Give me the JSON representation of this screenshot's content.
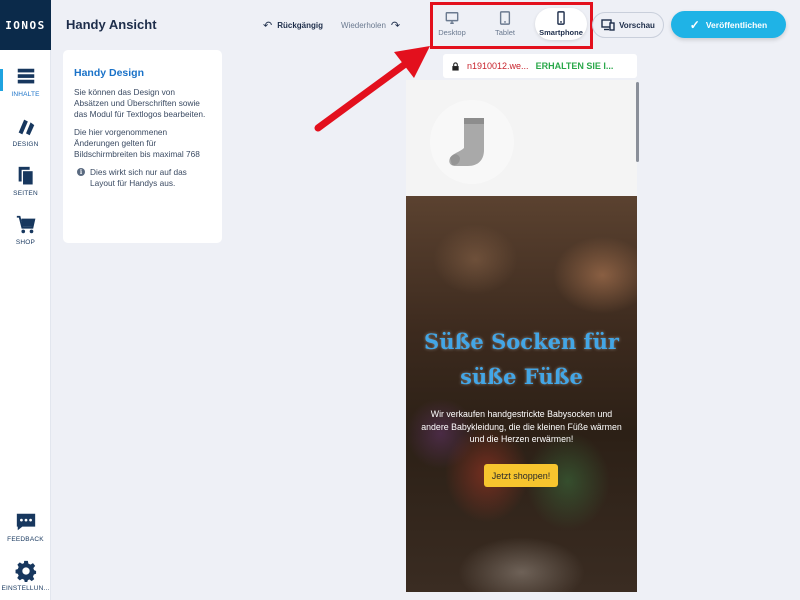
{
  "app": {
    "logo_text": "IONOS",
    "page_title": "Handy Ansicht"
  },
  "sidebar": {
    "items": [
      {
        "label": "INHALTE",
        "icon": "content-icon",
        "active": true
      },
      {
        "label": "DESIGN",
        "icon": "design-icon",
        "active": false
      },
      {
        "label": "SEITEN",
        "icon": "pages-icon",
        "active": false
      },
      {
        "label": "SHOP",
        "icon": "cart-icon",
        "active": false
      },
      {
        "label": "FEEDBACK",
        "icon": "feedback-icon",
        "active": false
      },
      {
        "label": "EINSTELLUN...",
        "icon": "gear-icon",
        "active": false
      }
    ]
  },
  "toolbar": {
    "undo_label": "Rückgängig",
    "redo_label": "Wiederholen",
    "devices": [
      {
        "label": "Desktop",
        "icon": "desktop-icon",
        "active": false
      },
      {
        "label": "Tablet",
        "icon": "tablet-icon",
        "active": false
      },
      {
        "label": "Smartphone",
        "icon": "smartphone-icon",
        "active": true
      }
    ],
    "preview_label": "Vorschau",
    "publish_label": "Veröffentlichen"
  },
  "info_card": {
    "title": "Handy Design",
    "paragraph1": "Sie können das Design von Absätzen und Überschriften sowie das Modul für Textlogos bearbeiten.",
    "paragraph2": "Die hier vorgenommenen Änderungen gelten für Bildschirmbreiten bis maximal 768",
    "note": "Dies wirkt sich nur auf das Layout für Handys aus."
  },
  "preview": {
    "url_domain": "n1910012.we...",
    "url_banner": "ERHALTEN SIE I...",
    "hero_title_line1": "Süße Socken für",
    "hero_title_line2": "süße Füße",
    "hero_text": "Wir verkaufen handgestrickte Babysocken und andere Babykleidung, die die kleinen Füße wärmen und die Herzen erwärmen!",
    "cta_label": "Jetzt shoppen!"
  },
  "colors": {
    "accent": "#1fb3e6",
    "brand_dark": "#0b2a4a",
    "highlight": "#e3101d",
    "cta": "#f7c52e",
    "hero_title": "#43a6e6"
  }
}
